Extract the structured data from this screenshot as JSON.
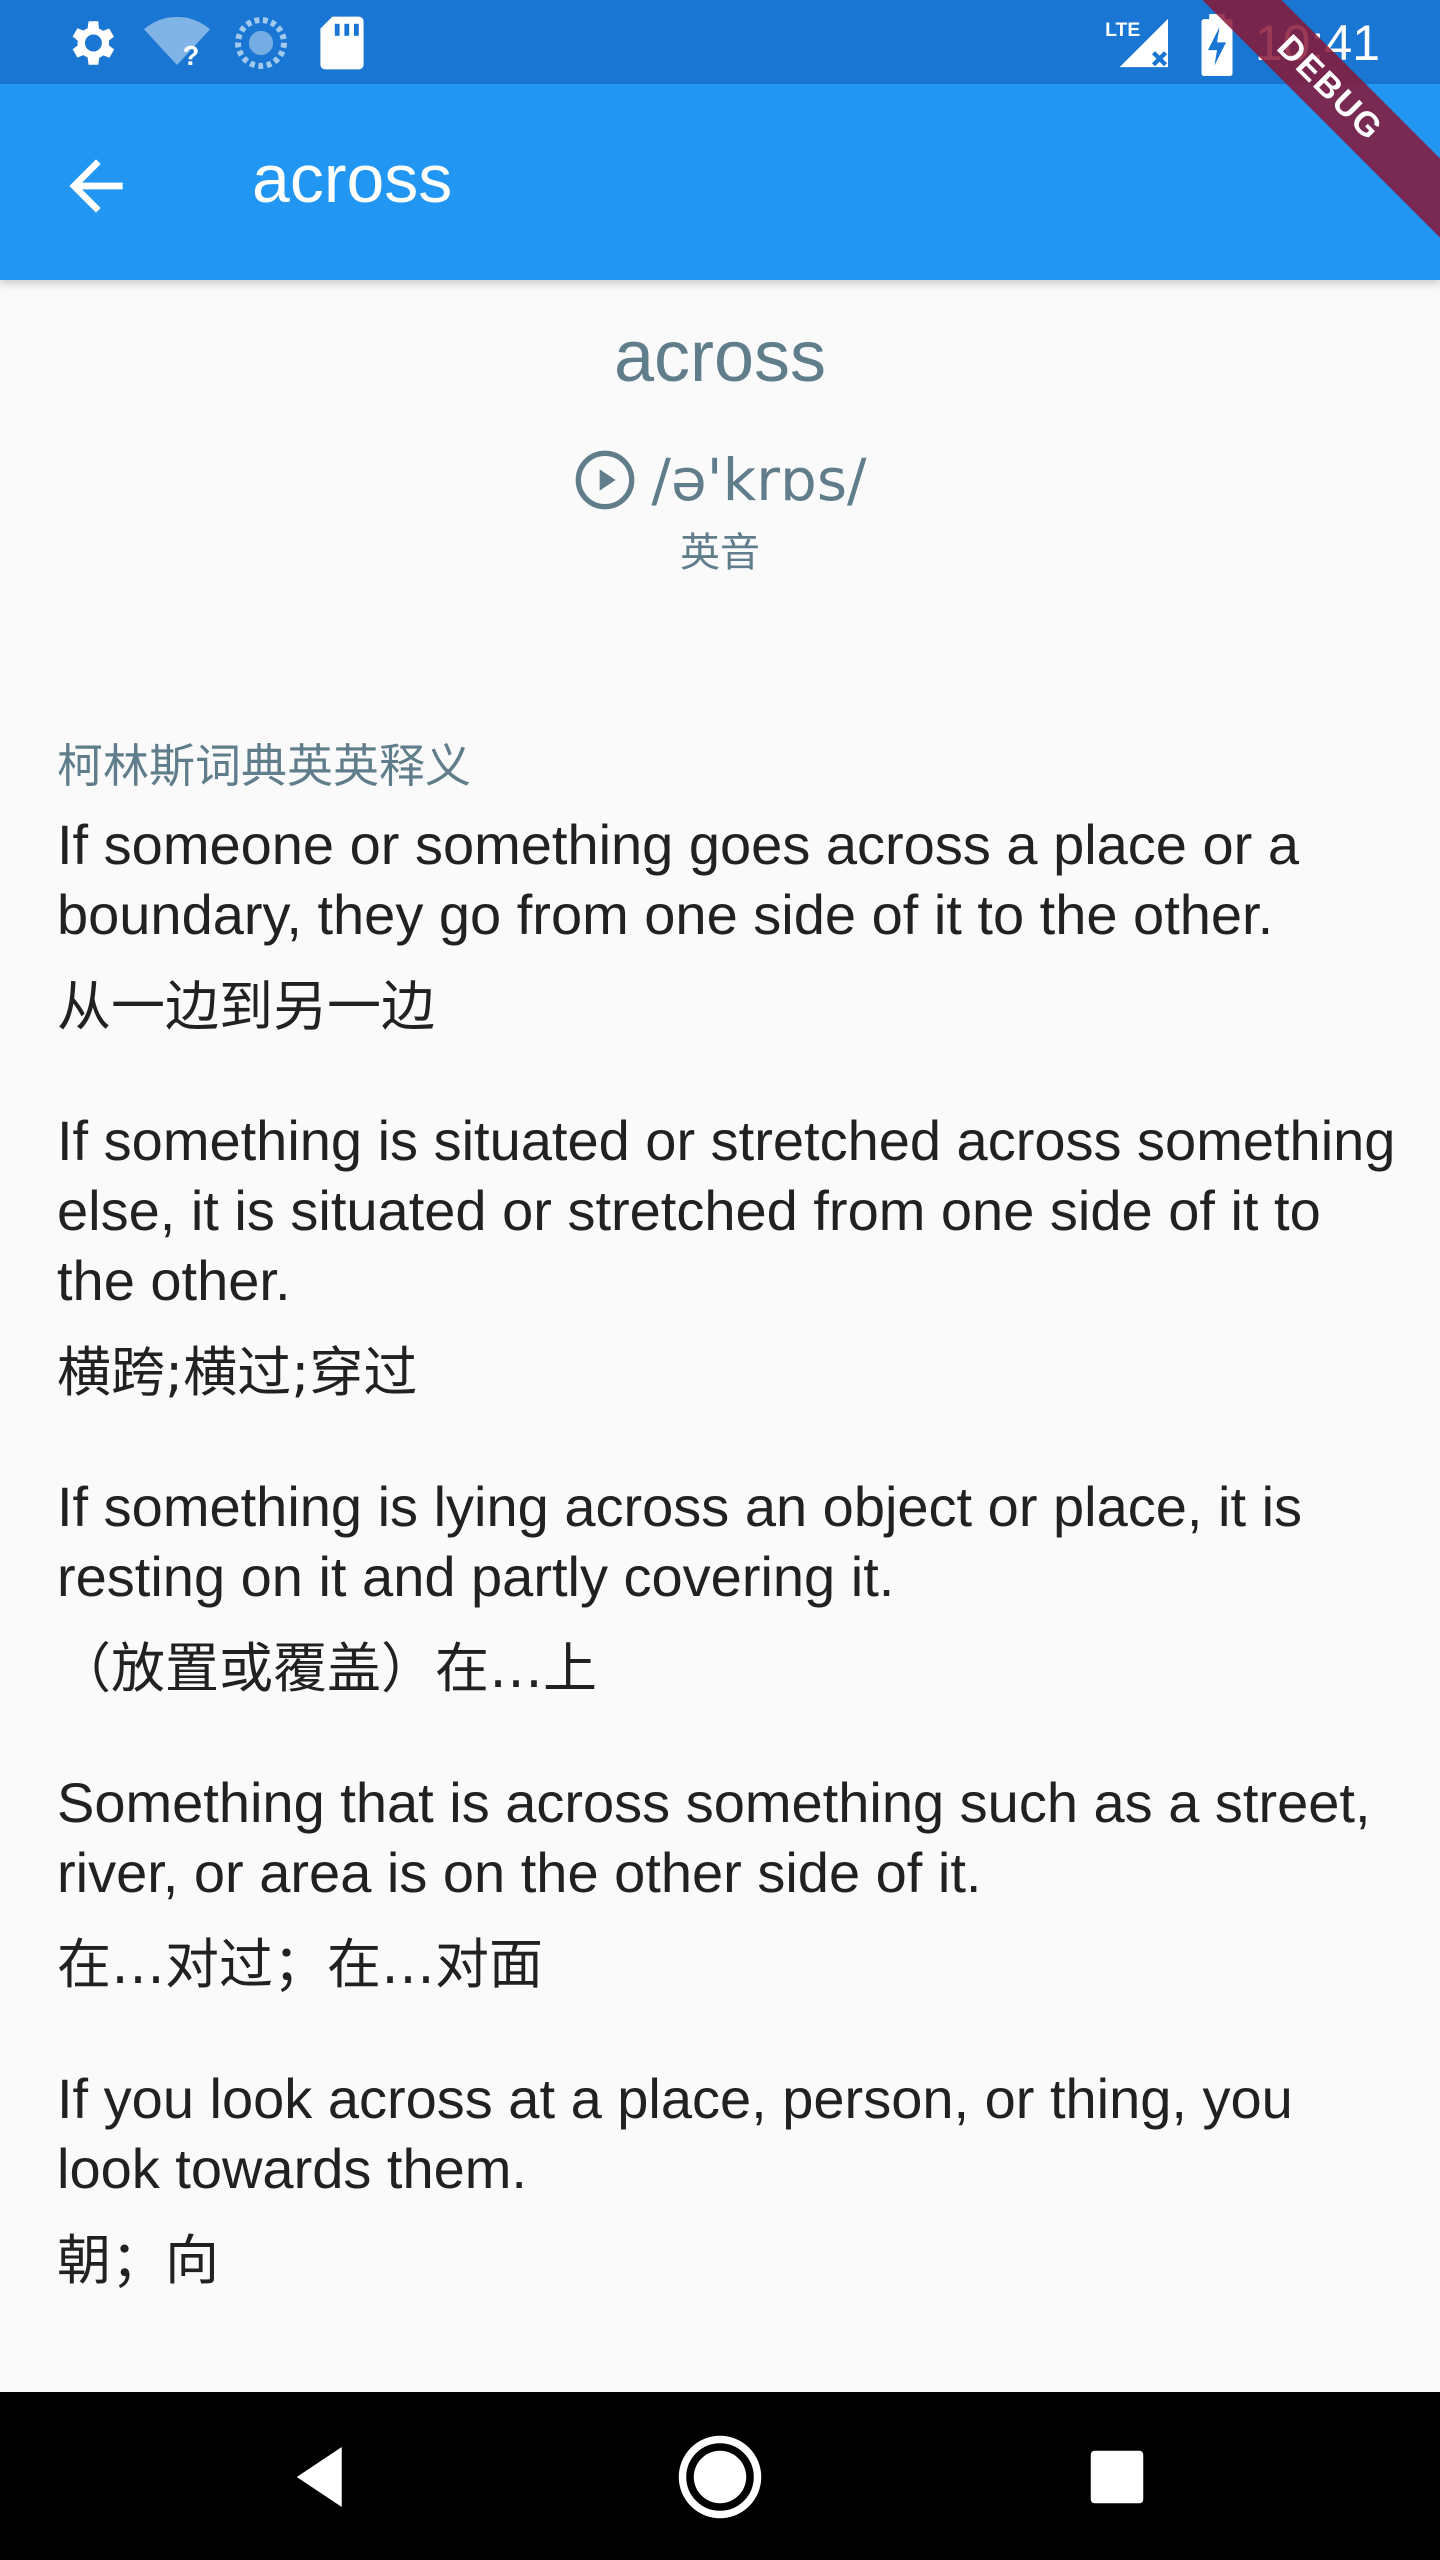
{
  "status_bar": {
    "time": "10:41",
    "icons": [
      "gear-icon",
      "wifi-unknown-icon",
      "sync-icon",
      "sd-card-icon",
      "lte-signal-icon",
      "battery-charging-icon"
    ],
    "background": "#1976d2"
  },
  "app_bar": {
    "title": "across",
    "back_icon": "arrow-back-icon",
    "background": "#2196f3"
  },
  "debug_banner": "DEBUG",
  "entry": {
    "headword": "across",
    "phonetic": "/ə'krɒs/",
    "accent_label": "英音",
    "source_label": "柯林斯词典英英释义",
    "accent_color": "#607d8b",
    "definitions": [
      {
        "en": "If someone or something goes across a place or a boundary, they go from one side of it to the other.",
        "cn": "从一边到另一边"
      },
      {
        "en": "If something is situated or stretched across something else, it is situated or stretched from one side of it to the other.",
        "cn": "横跨;横过;穿过"
      },
      {
        "en": "If something is lying across an object or place, it is resting on it and partly covering it.",
        "cn": "（放置或覆盖）在…上"
      },
      {
        "en": "Something that is across something such as a street, river, or area is on the other side of it.",
        "cn": "在…对过；在…对面"
      },
      {
        "en": "If you look across at a place, person, or thing, you look towards them.",
        "cn": "朝；向"
      }
    ]
  },
  "nav_bar": {
    "icons": [
      "back-triangle-icon",
      "home-circle-icon",
      "recents-square-icon"
    ]
  }
}
